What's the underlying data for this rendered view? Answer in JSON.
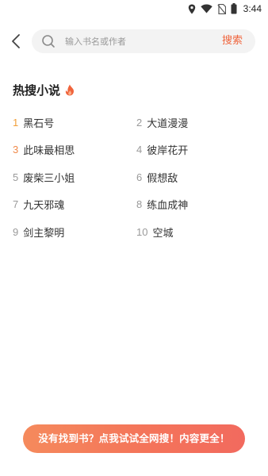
{
  "status_bar": {
    "time": "3:44",
    "icons": [
      "location-icon",
      "wifi-icon",
      "no-sim-icon",
      "battery-icon"
    ]
  },
  "search": {
    "placeholder": "输入书名或作者",
    "value": "",
    "button_label": "搜索"
  },
  "hot_section": {
    "title": "热搜小说",
    "icon": "flame-icon",
    "accent": "#f0643c",
    "items": [
      {
        "rank": "1",
        "title": "黑石号"
      },
      {
        "rank": "2",
        "title": "大道漫漫"
      },
      {
        "rank": "3",
        "title": "此味最相思"
      },
      {
        "rank": "4",
        "title": "彼岸花开"
      },
      {
        "rank": "5",
        "title": "废柴三小姐"
      },
      {
        "rank": "6",
        "title": "假想敌"
      },
      {
        "rank": "7",
        "title": "九天邪魂"
      },
      {
        "rank": "8",
        "title": "练血成神"
      },
      {
        "rank": "9",
        "title": "剑主黎明"
      },
      {
        "rank": "10",
        "title": "空城"
      }
    ]
  },
  "banner": {
    "label": "没有找到书？点我试试全网搜！内容更全！",
    "color_start": "#f58a5c",
    "color_end": "#f26a5e"
  }
}
